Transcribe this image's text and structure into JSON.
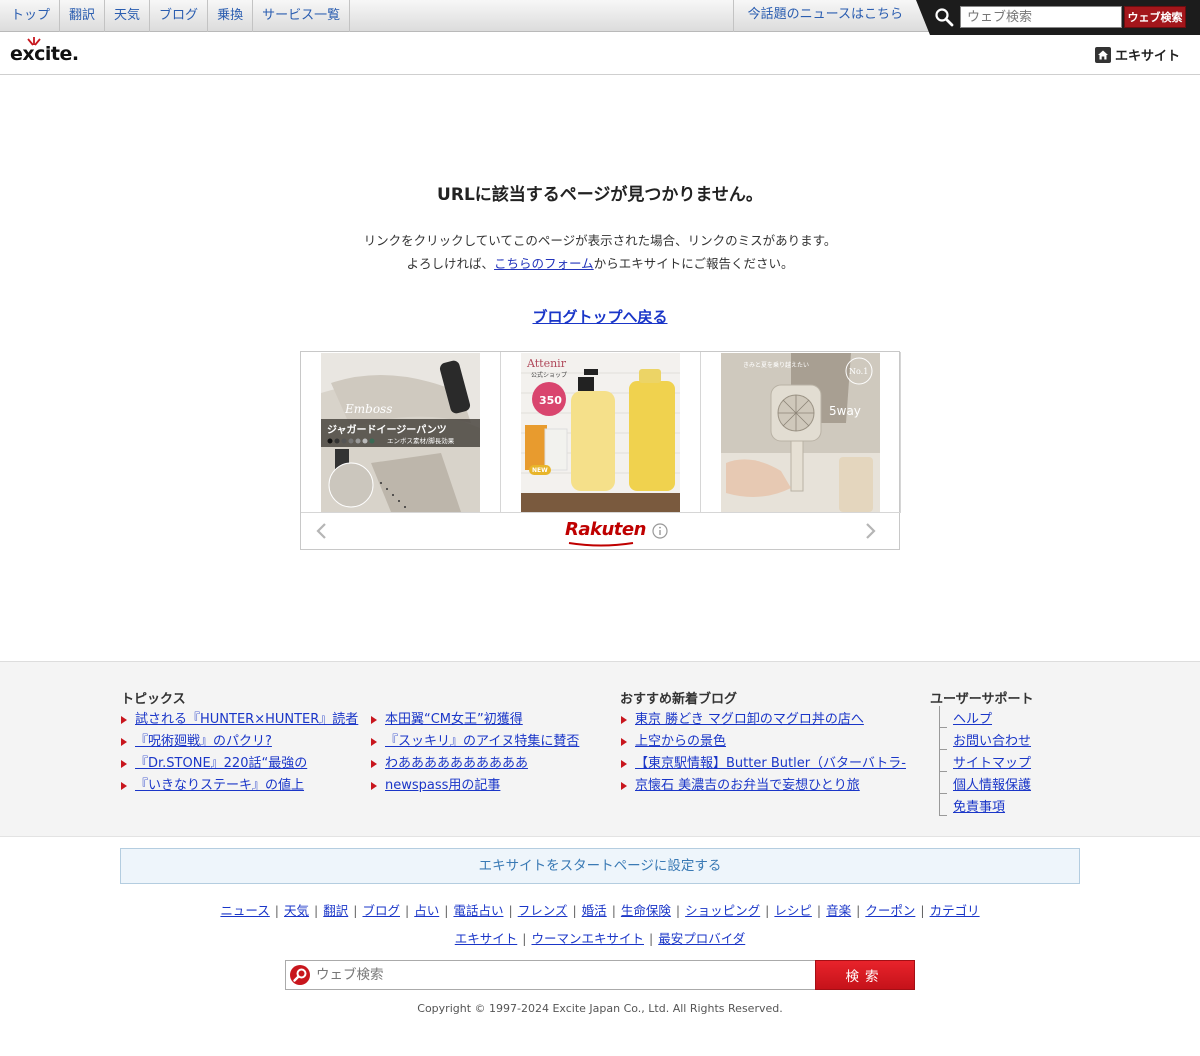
{
  "topnav": {
    "items": [
      "トップ",
      "翻訳",
      "天気",
      "ブログ",
      "乗換",
      "サービス一覧"
    ],
    "hot_news": "今話題のニュースはこちら",
    "search_placeholder": "ウェブ検索",
    "search_button": "ウェブ検索"
  },
  "header": {
    "logo": "excite.",
    "home_label": "エキサイト"
  },
  "error": {
    "title": "URLに該当するページが見つかりません。",
    "line1": "リンクをクリックしていてこのページが表示された場合、リンクのミスがあります。",
    "line2_pre": "よろしければ、",
    "line2_link": "こちらのフォーム",
    "line2_post": "からエキサイトにご報告ください。",
    "back_link": "ブログトップへ戻る"
  },
  "ad": {
    "brand": "Rakuten",
    "items": [
      {
        "text1": "ジャガードイージーパンツ",
        "text2": "エンボス素材/脚長効果",
        "script": "Emboss"
      },
      {
        "text1": "Attenir",
        "text2": "公式ショップ",
        "badge": "350",
        "new": "NEW"
      },
      {
        "text1": "5way",
        "text2": "きみと夏を乗り越えたい",
        "badge": "No.1"
      }
    ]
  },
  "footer_links": {
    "topics": {
      "heading": "トピックス",
      "col1": [
        "試される『HUNTER×HUNTER』読者",
        "『呪術廻戦』のパクリ?",
        "『Dr.STONE』220話“最強の",
        "『いきなりステーキ』の値上"
      ],
      "col2": [
        "本田翼“CM女王”初獲得",
        "『スッキリ』のアイヌ特集に賛否",
        "わああああああああああ",
        "newspass用の記事"
      ]
    },
    "blogs": {
      "heading": "おすすめ新着ブログ",
      "items": [
        "東京 勝どき マグロ卸のマグロ丼の店へ",
        "上空からの景色",
        "【東京駅情報】Butter Butler（バターバトラ-",
        "京懐石 美濃吉のお弁当で妄想ひとり旅"
      ]
    },
    "support": {
      "heading": "ユーザーサポート",
      "items": [
        "ヘルプ",
        "お問い合わせ",
        "サイトマップ",
        "個人情報保護",
        "免責事項"
      ]
    }
  },
  "bottom": {
    "set_start": "エキサイトをスタートページに設定する",
    "services_row1": [
      "ニュース",
      "天気",
      "翻訳",
      "ブログ",
      "占い",
      "電話占い",
      "フレンズ",
      "婚活",
      "生命保険",
      "ショッピング",
      "レシピ",
      "音楽",
      "クーポン",
      "カテゴリ"
    ],
    "services_row2": [
      "エキサイト",
      "ウーマンエキサイト",
      "最安プロバイダ"
    ],
    "search_placeholder": "ウェブ検索",
    "search_button": "検索",
    "copyright": "Copyright © 1997-2024 Excite Japan Co., Ltd. All Rights Reserved."
  },
  "colors": {
    "accent_red": "#c8161d",
    "link_blue": "#1a36c8",
    "nav_blue": "#2a5db0"
  }
}
